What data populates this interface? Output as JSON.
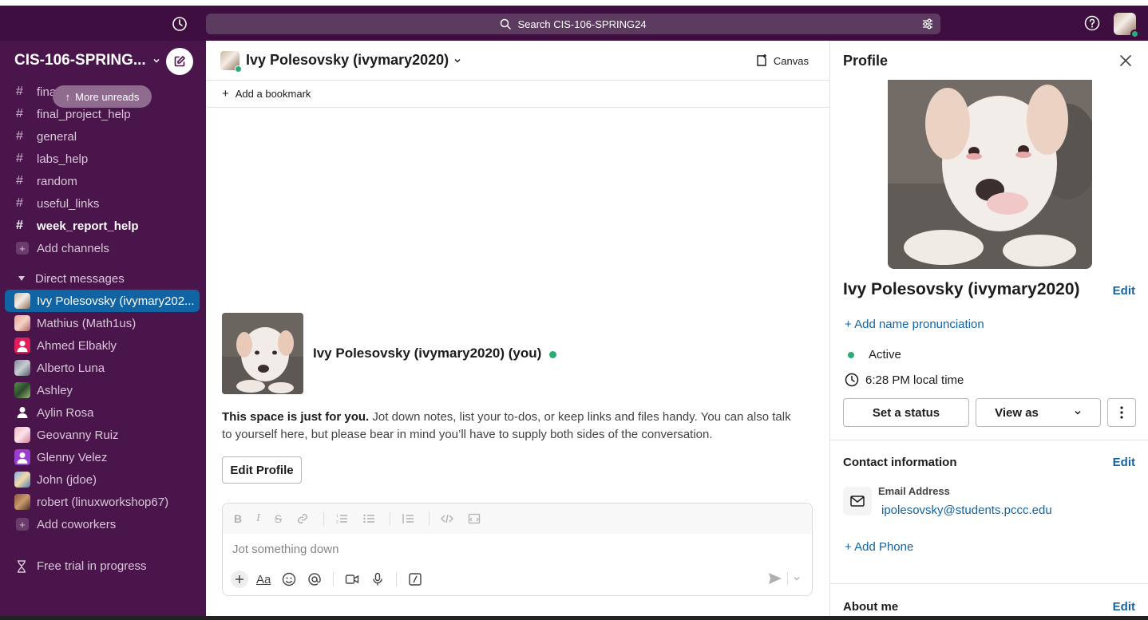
{
  "topbar": {
    "search_placeholder": "Search CIS-106-SPRING24"
  },
  "workspace": {
    "name": "CIS-106-SPRING..."
  },
  "sidebar": {
    "more_unreads": "More unreads",
    "channels": [
      {
        "name": "fina",
        "bold": false
      },
      {
        "name": "final_project_help",
        "bold": false
      },
      {
        "name": "general",
        "bold": false
      },
      {
        "name": "labs_help",
        "bold": false
      },
      {
        "name": "random",
        "bold": false
      },
      {
        "name": "useful_links",
        "bold": false
      },
      {
        "name": "week_report_help",
        "bold": true
      }
    ],
    "add_channels": "Add channels",
    "dm_section": "Direct messages",
    "dms": [
      {
        "name": "Ivy Polesovsky (ivymary202...",
        "active": true
      },
      {
        "name": "Mathius (Math1us)"
      },
      {
        "name": "Ahmed Elbakly"
      },
      {
        "name": "Alberto Luna"
      },
      {
        "name": "Ashley"
      },
      {
        "name": "Aylin Rosa"
      },
      {
        "name": "Geovanny Ruiz"
      },
      {
        "name": "Glenny Velez"
      },
      {
        "name": "John (jdoe)"
      },
      {
        "name": "robert (linuxworkshop67)"
      }
    ],
    "add_coworkers": "Add coworkers",
    "trial": "Free trial in progress"
  },
  "channel": {
    "title": "Ivy Polesovsky (ivymary2020)",
    "canvas_label": "Canvas",
    "add_bookmark": "Add a bookmark",
    "intro_name": "Ivy Polesovsky (ivymary2020) (you)",
    "intro_bold": "This space is just for you.",
    "intro_rest": " Jot down notes, list your to-dos, or keep links and files handy. You can also talk to yourself here, but please bear in mind you’ll have to supply both sides of the conversation.",
    "edit_profile": "Edit Profile",
    "composer_placeholder": "Jot something down"
  },
  "profile": {
    "header": "Profile",
    "name": "Ivy Polesovsky (ivymary2020)",
    "edit": "Edit",
    "add_pronunciation": "+ Add name pronunciation",
    "status": "Active",
    "local_time": "6:28 PM local time",
    "set_status": "Set a status",
    "view_as": "View as",
    "contact_title": "Contact information",
    "email_label": "Email Address",
    "email": "ipolesovsky@students.pccc.edu",
    "add_phone": "+ Add Phone",
    "about_title": "About me"
  },
  "colors": {
    "topbar": "#3f0e40",
    "sidebar": "#4a154b",
    "active_item": "#1164a3",
    "link": "#1264a3",
    "presence": "#2bac76"
  }
}
